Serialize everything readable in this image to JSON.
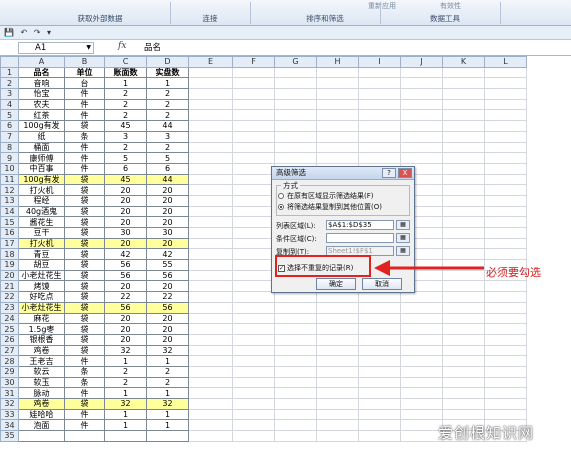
{
  "ribbon": {
    "groups": [
      "获取外部数据",
      "连接",
      "排序和筛选",
      "数据工具"
    ],
    "faded": [
      "重新应用",
      "有效性"
    ]
  },
  "formula_bar": {
    "cell_ref": "A1",
    "fx": "fx",
    "content": "品名"
  },
  "columns": [
    "A",
    "B",
    "C",
    "D",
    "E",
    "F",
    "G",
    "H",
    "I",
    "J",
    "K",
    "L"
  ],
  "rows": [
    {
      "n": "1",
      "a": "品名",
      "b": "单位",
      "c": "账面数",
      "d": "实盘数"
    },
    {
      "n": "2",
      "a": "音响",
      "b": "台",
      "c": "1",
      "d": "1"
    },
    {
      "n": "3",
      "a": "怡宝",
      "b": "件",
      "c": "2",
      "d": "2"
    },
    {
      "n": "4",
      "a": "农夫",
      "b": "件",
      "c": "2",
      "d": "2"
    },
    {
      "n": "5",
      "a": "红茶",
      "b": "件",
      "c": "2",
      "d": "2"
    },
    {
      "n": "6",
      "a": "100g有发",
      "b": "袋",
      "c": "45",
      "d": "44"
    },
    {
      "n": "7",
      "a": "纸",
      "b": "条",
      "c": "3",
      "d": "3"
    },
    {
      "n": "8",
      "a": "桶面",
      "b": "件",
      "c": "2",
      "d": "2"
    },
    {
      "n": "9",
      "a": "康师傅",
      "b": "件",
      "c": "5",
      "d": "5"
    },
    {
      "n": "10",
      "a": "中百事",
      "b": "件",
      "c": "6",
      "d": "6"
    },
    {
      "n": "11",
      "a": "100g有发",
      "b": "袋",
      "c": "45",
      "d": "44"
    },
    {
      "n": "12",
      "a": "打火机",
      "b": "袋",
      "c": "20",
      "d": "20"
    },
    {
      "n": "13",
      "a": "程经",
      "b": "袋",
      "c": "20",
      "d": "20"
    },
    {
      "n": "14",
      "a": "40g酒鬼",
      "b": "袋",
      "c": "20",
      "d": "20"
    },
    {
      "n": "15",
      "a": "酱花生",
      "b": "袋",
      "c": "20",
      "d": "20"
    },
    {
      "n": "16",
      "a": "豆干",
      "b": "袋",
      "c": "30",
      "d": "30"
    },
    {
      "n": "17",
      "a": "打火机",
      "b": "袋",
      "c": "20",
      "d": "20"
    },
    {
      "n": "18",
      "a": "青豆",
      "b": "袋",
      "c": "42",
      "d": "42"
    },
    {
      "n": "19",
      "a": "胡豆",
      "b": "袋",
      "c": "56",
      "d": "55"
    },
    {
      "n": "20",
      "a": "小老灶花生",
      "b": "袋",
      "c": "56",
      "d": "56"
    },
    {
      "n": "21",
      "a": "烤馍",
      "b": "袋",
      "c": "20",
      "d": "20"
    },
    {
      "n": "22",
      "a": "好吃点",
      "b": "袋",
      "c": "22",
      "d": "22"
    },
    {
      "n": "23",
      "a": "小老灶花生",
      "b": "袋",
      "c": "56",
      "d": "56"
    },
    {
      "n": "24",
      "a": "麻花",
      "b": "袋",
      "c": "20",
      "d": "20"
    },
    {
      "n": "25",
      "a": "1.5g枣",
      "b": "袋",
      "c": "20",
      "d": "20"
    },
    {
      "n": "26",
      "a": "银根香",
      "b": "袋",
      "c": "20",
      "d": "20"
    },
    {
      "n": "27",
      "a": "鸡卷",
      "b": "袋",
      "c": "32",
      "d": "32"
    },
    {
      "n": "28",
      "a": "王老吉",
      "b": "件",
      "c": "1",
      "d": "1"
    },
    {
      "n": "29",
      "a": "软云",
      "b": "条",
      "c": "2",
      "d": "2"
    },
    {
      "n": "30",
      "a": "软玉",
      "b": "条",
      "c": "2",
      "d": "2"
    },
    {
      "n": "31",
      "a": "脉动",
      "b": "件",
      "c": "1",
      "d": "1"
    },
    {
      "n": "32",
      "a": "鸡卷",
      "b": "袋",
      "c": "32",
      "d": "32"
    },
    {
      "n": "33",
      "a": "娃哈哈",
      "b": "件",
      "c": "1",
      "d": "1"
    },
    {
      "n": "34",
      "a": "泡面",
      "b": "件",
      "c": "1",
      "d": "1"
    },
    {
      "n": "35",
      "a": "",
      "b": "",
      "c": "",
      "d": ""
    }
  ],
  "highlight_rows": [
    "11",
    "17",
    "23",
    "32"
  ],
  "dialog": {
    "title": "高级筛选",
    "help": "?",
    "close": "X",
    "method_label": "方式",
    "option1": "在原有区域显示筛选结果(F)",
    "option2": "将筛选结果复制到其他位置(O)",
    "list_range_label": "列表区域(L):",
    "list_range_value": "$A$1:$D$35",
    "criteria_label": "条件区域(C):",
    "criteria_value": "",
    "copy_to_label": "复制到(T):",
    "copy_to_value": "Sheet1!$F$1",
    "unique_label": "选择不重复的记录(R)",
    "ok": "确定",
    "cancel": "取消"
  },
  "annotation": {
    "note": "必须要勾选",
    "arrow_color": "#e0231f"
  },
  "watermark": "爱创根知识网"
}
